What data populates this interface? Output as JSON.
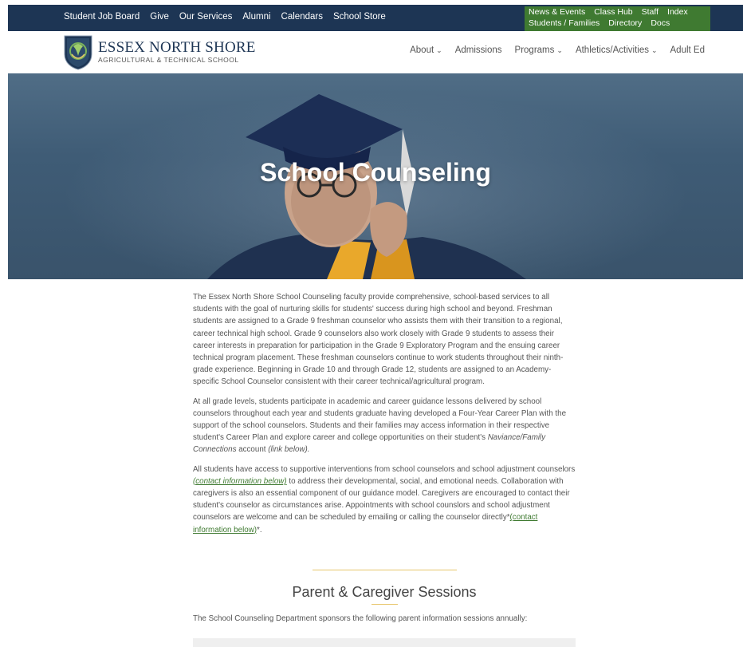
{
  "topbar": {
    "links": [
      "Student Job Board",
      "Give",
      "Our Services",
      "Alumni",
      "Calendars",
      "School Store"
    ],
    "secondary_row1": [
      "News & Events",
      "Class Hub",
      "Staff",
      "Index"
    ],
    "secondary_row2": [
      "Students / Families",
      "Directory",
      "Docs"
    ]
  },
  "header": {
    "logo_title": "ESSEX NORTH SHORE",
    "logo_subtitle": "AGRICULTURAL & TECHNICAL SCHOOL",
    "nav": [
      {
        "label": "About",
        "dropdown": true
      },
      {
        "label": "Admissions",
        "dropdown": false
      },
      {
        "label": "Programs",
        "dropdown": true
      },
      {
        "label": "Athletics/Activities",
        "dropdown": true
      },
      {
        "label": "Adult Ed",
        "dropdown": false
      }
    ]
  },
  "hero": {
    "title": "School Counseling"
  },
  "content": {
    "p1": "The Essex North Shore School Counseling faculty provide comprehensive, school-based services to all students with the goal of nurturing skills for students' success during high school and beyond. Freshman students are assigned to a Grade 9 freshman counselor who assists them with their transition to a regional, career technical high school.  Grade 9 counselors also work closely with Grade 9 students to assess their career interests in preparation for participation in the Grade 9 Exploratory Program and the ensuing career technical program placement. These freshman counselors continue to work students throughout their ninth-grade experience.  Beginning in Grade 10 and through Grade 12, students are assigned to an Academy-specific School Counselor consistent with their career technical/agricultural program.",
    "p2_a": "At all grade levels, students participate in academic and career guidance lessons delivered by school counselors throughout each year and students graduate having developed a Four-Year Career Plan with the support of the school counselors.  Students and their families may access information in their respective student's Career Plan and explore career and college opportunities on their student's ",
    "p2_em": "Naviance/Family Connections",
    "p2_b": " account ",
    "p2_em2": "(link below).",
    "p3_a": "All students have access to supportive interventions from school counselors and school adjustment counselors ",
    "p3_link1": "(contact information below)",
    "p3_b": " to address their developmental, social, and emotional needs. Collaboration with caregivers is also an essential component of our guidance model. Caregivers are encouraged to contact their student's counselor as circumstances arise. Appointments with school counslors and school adjustment counselors are welcome and can be scheduled by emailing or calling the counselor directly*",
    "p3_link2": "(contact information below)",
    "p3_c": "*."
  },
  "section": {
    "title": "Parent & Caregiver Sessions",
    "intro": "The School Counseling Department sponsors the following parent information sessions annually:"
  },
  "colors": {
    "navy": "#1d3554",
    "green": "#3f7a31",
    "gold": "#e7c66c"
  }
}
